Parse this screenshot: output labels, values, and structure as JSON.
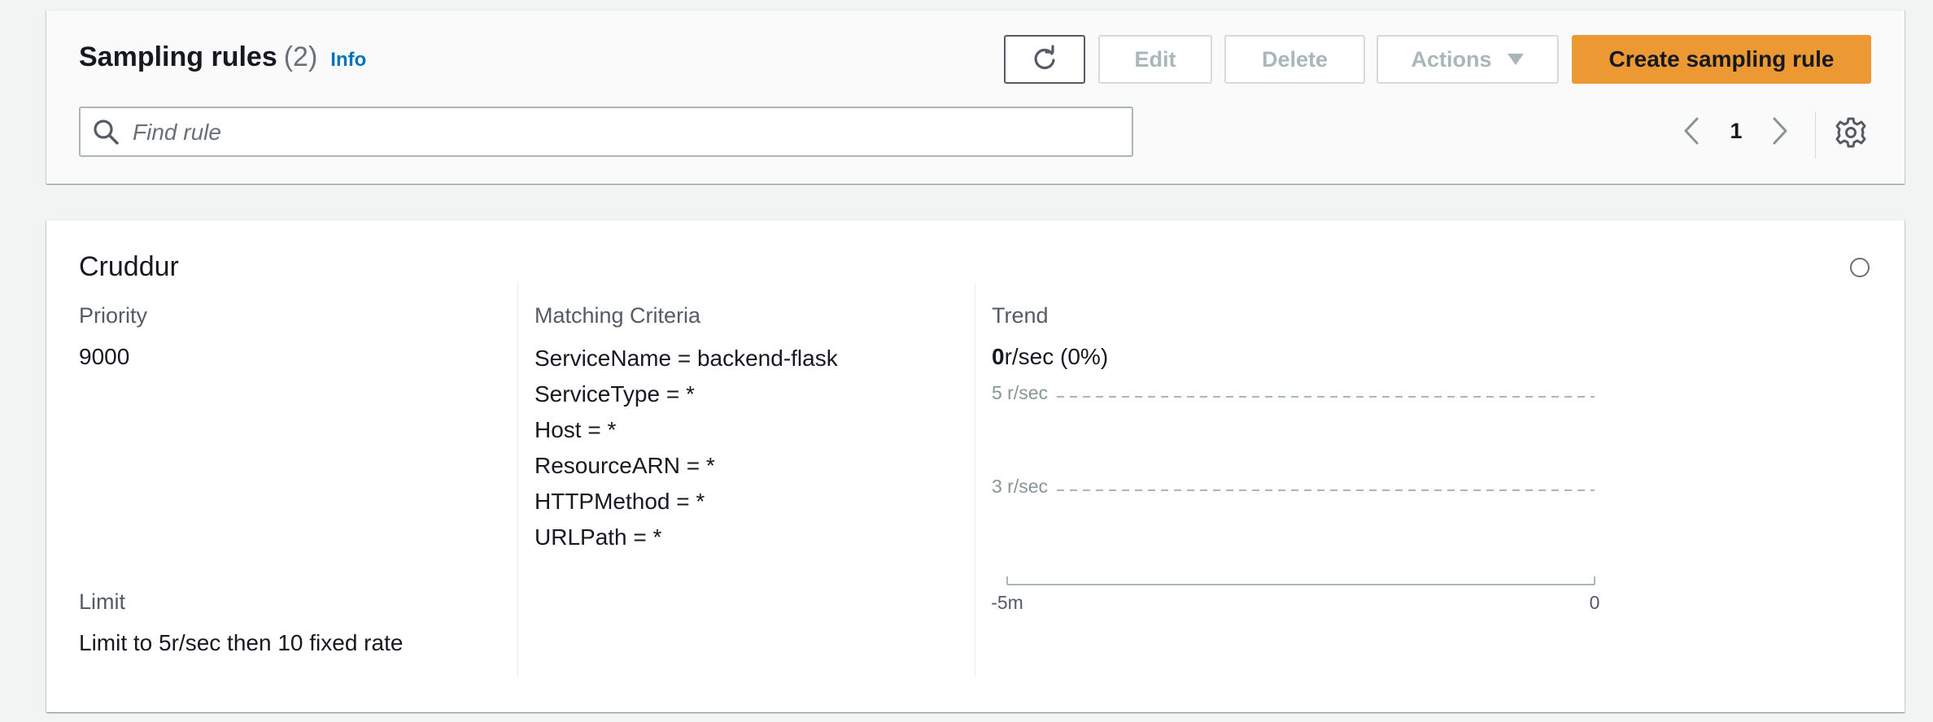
{
  "header": {
    "title": "Sampling rules",
    "count": "(2)",
    "info_link": "Info"
  },
  "toolbar": {
    "edit_label": "Edit",
    "delete_label": "Delete",
    "actions_label": "Actions",
    "create_label": "Create sampling rule"
  },
  "search": {
    "placeholder": "Find rule",
    "value": ""
  },
  "pagination": {
    "current_page": "1"
  },
  "rule": {
    "name": "Cruddur",
    "priority_label": "Priority",
    "priority_value": "9000",
    "limit_label": "Limit",
    "limit_value": "Limit to 5r/sec then 10 fixed rate",
    "criteria_label": "Matching Criteria",
    "criteria": [
      "ServiceName = backend-flask",
      "ServiceType = *",
      "Host = *",
      "ResourceARN = *",
      "HTTPMethod = *",
      "URLPath = *"
    ],
    "trend_label": "Trend",
    "trend_rate": "0",
    "trend_suffix": "r/sec (0%)"
  },
  "chart_data": {
    "type": "line",
    "y_gridlines": [
      "5 r/sec",
      "3 r/sec"
    ],
    "x_ticks": [
      "-5m",
      "0"
    ],
    "series": []
  },
  "colors": {
    "primary_button": "#ec9933",
    "link": "#0073bb",
    "background": "#f2f3f3"
  },
  "icons": {
    "refresh": "refresh-icon",
    "search": "search-icon",
    "prev": "chevron-left-icon",
    "next": "chevron-right-icon",
    "settings": "gear-icon",
    "actions_caret": "caret-down-icon"
  }
}
